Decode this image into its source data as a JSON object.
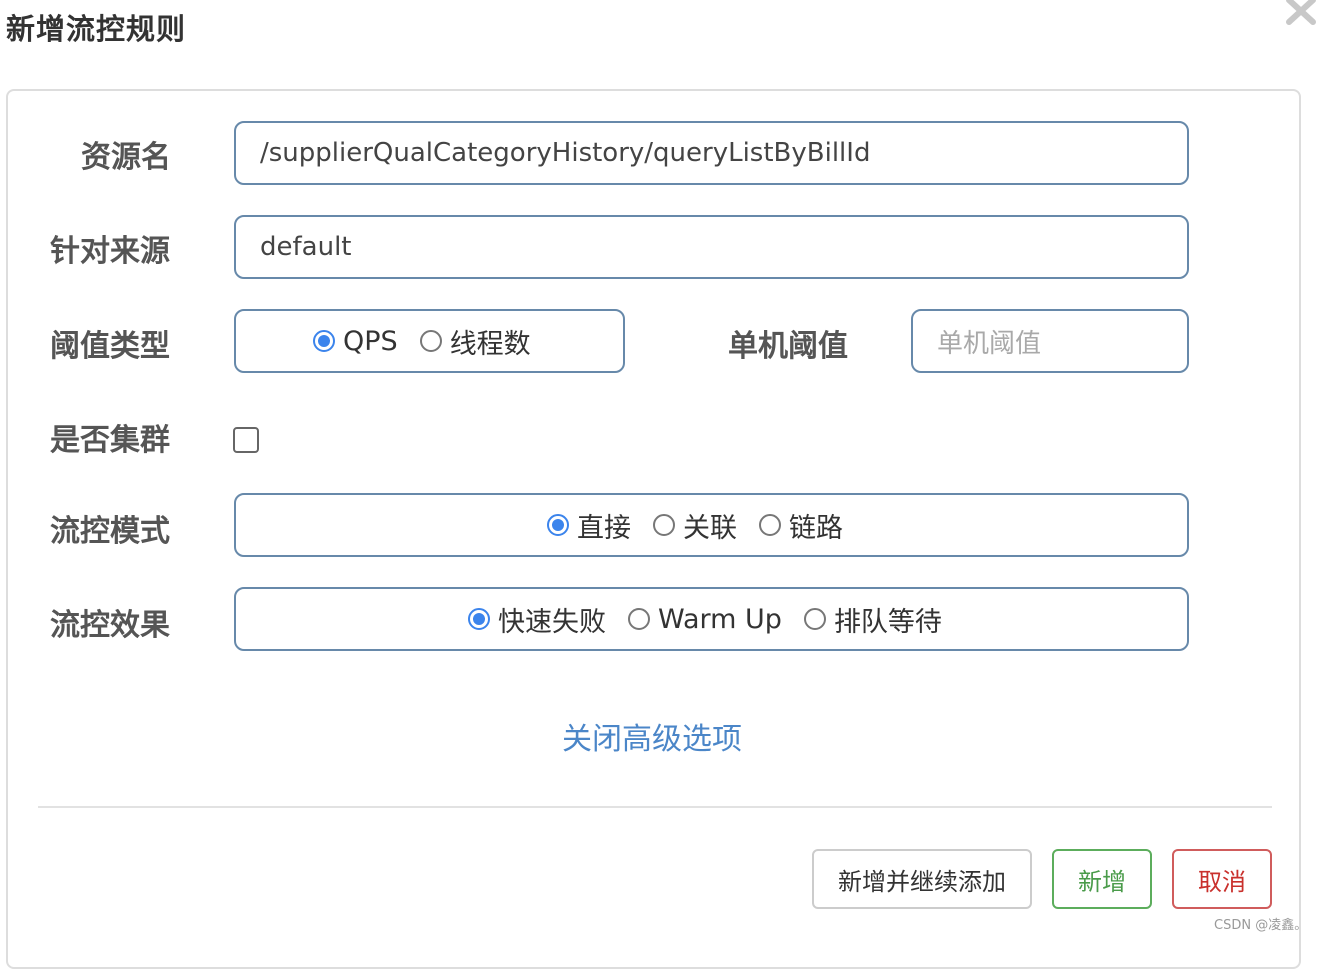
{
  "dialog": {
    "title": "新增流控规则",
    "close_icon": "close-icon"
  },
  "form": {
    "resource": {
      "label": "资源名",
      "value": "/supplierQualCategoryHistory/queryListByBillId"
    },
    "limit_app": {
      "label": "针对来源",
      "value": "default"
    },
    "threshold_type": {
      "label": "阈值类型",
      "options": [
        "QPS",
        "线程数"
      ],
      "selected": "QPS"
    },
    "single_threshold": {
      "label": "单机阈值",
      "placeholder": "单机阈值"
    },
    "cluster": {
      "label": "是否集群",
      "checked": false
    },
    "strategy": {
      "label": "流控模式",
      "options": [
        "直接",
        "关联",
        "链路"
      ],
      "selected": "直接"
    },
    "control_behavior": {
      "label": "流控效果",
      "options": [
        "快速失败",
        "Warm Up",
        "排队等待"
      ],
      "selected": "快速失败"
    },
    "advanced_toggle": "关闭高级选项"
  },
  "footer": {
    "add_continue_label": "新增并继续添加",
    "add_label": "新增",
    "cancel_label": "取消"
  },
  "watermark": "CSDN @凌鑫。",
  "colors": {
    "border": "#6789aa",
    "radio_checked": "#3b84ec",
    "link": "#4b86c8",
    "add_button": "#5cad5c",
    "cancel_button": "#d05c5c"
  }
}
